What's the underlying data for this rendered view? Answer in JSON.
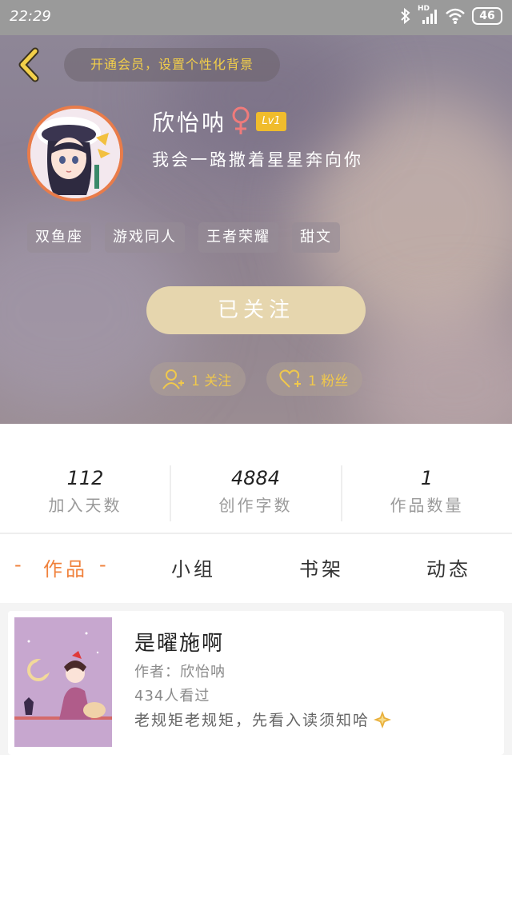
{
  "status_bar": {
    "time": "22:29",
    "battery": "46",
    "network_label": "HD"
  },
  "header": {
    "vip_banner": "开通会员，设置个性化背景",
    "username": "欣怡呐",
    "gender_icon": "female-icon",
    "level": "Lv1",
    "signature": "我会一路撒着星星奔向你",
    "tags": [
      "双鱼座",
      "游戏同人",
      "王者荣耀",
      "甜文"
    ],
    "follow_button": "已关注",
    "following": "1 关注",
    "fans": "1 粉丝"
  },
  "stats": [
    {
      "value": "112",
      "label": "加入天数"
    },
    {
      "value": "4884",
      "label": "创作字数"
    },
    {
      "value": "1",
      "label": "作品数量"
    }
  ],
  "tabs": [
    {
      "label": "作品",
      "active": true
    },
    {
      "label": "小组",
      "active": false
    },
    {
      "label": "书架",
      "active": false
    },
    {
      "label": "动态",
      "active": false
    }
  ],
  "active_tab_decoration": "-",
  "works": [
    {
      "title": "是曜施啊",
      "author": "作者：欣怡呐",
      "views": "434人看过",
      "description": "老规矩老规矩，先看入读须知哈"
    }
  ],
  "colors": {
    "accent": "#f0823d",
    "vip_text": "#f3cf4a",
    "follow_button": "#e6d6ae",
    "level_badge": "#f0bc2c",
    "avatar_border": "#e97c4a",
    "gender": "#f07b7b"
  }
}
